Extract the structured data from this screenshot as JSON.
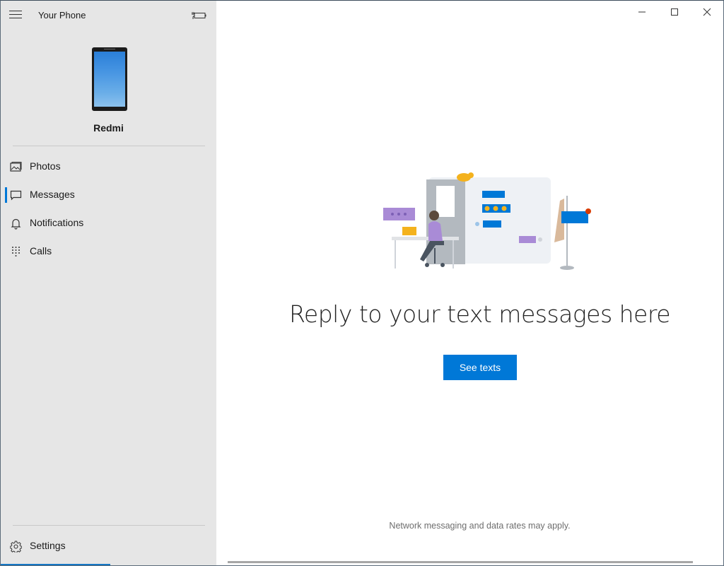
{
  "app": {
    "title": "Your Phone",
    "window_controls": {
      "minimize": "minimize-icon",
      "maximize": "maximize-icon",
      "close": "close-icon"
    }
  },
  "sidebar": {
    "menu_icon": "hamburger-icon",
    "battery_icon": "battery-charging-icon",
    "device": {
      "name": "Redmi",
      "icon": "phone-icon"
    },
    "items": [
      {
        "label": "Photos",
        "icon": "photos-icon",
        "active": false
      },
      {
        "label": "Messages",
        "icon": "message-icon",
        "active": true
      },
      {
        "label": "Notifications",
        "icon": "bell-icon",
        "active": false
      },
      {
        "label": "Calls",
        "icon": "dialpad-icon",
        "active": false
      }
    ],
    "settings": {
      "label": "Settings",
      "icon": "gear-icon"
    }
  },
  "main": {
    "illustration": "messaging-illustration",
    "headline": "Reply to your text messages here",
    "primary_button": "See texts",
    "footnote": "Network messaging and data rates may apply."
  },
  "colors": {
    "accent": "#0078d7",
    "sidebar_bg": "#e6e6e6",
    "illustration_purple": "#a98bd6",
    "illustration_orange": "#f4b21d"
  }
}
